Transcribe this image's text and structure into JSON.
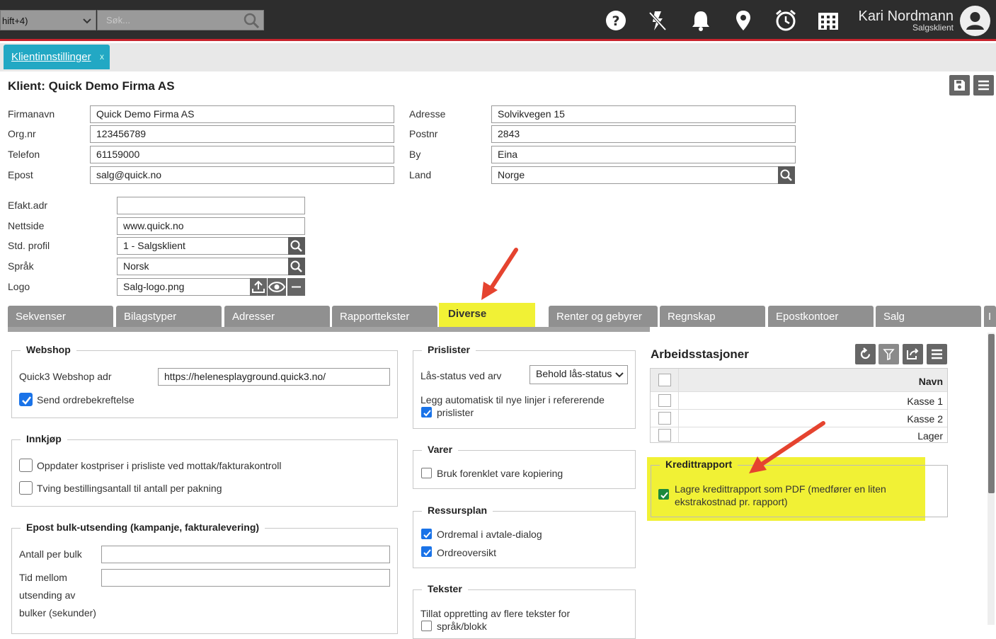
{
  "topbar": {
    "shortcut_text": "hift+4)",
    "search_placeholder": "Søk...",
    "user_name": "Kari Nordmann",
    "user_role": "Salgsklient"
  },
  "app_tab": {
    "label": "Klientinnstillinger",
    "close": "x"
  },
  "page_title": "Klient: Quick Demo Firma AS",
  "client_left": [
    {
      "label": "Firmanavn",
      "value": "Quick Demo Firma AS"
    },
    {
      "label": "Org.nr",
      "value": "123456789"
    },
    {
      "label": "Telefon",
      "value": "61159000"
    },
    {
      "label": "Epost",
      "value": "salg@quick.no"
    }
  ],
  "client_right": [
    {
      "label": "Adresse",
      "value": "Solvikvegen 15"
    },
    {
      "label": "Postnr",
      "value": "2843"
    },
    {
      "label": "By",
      "value": "Eina"
    },
    {
      "label": "Land",
      "value": "Norge"
    }
  ],
  "client_extra": [
    {
      "label": "Efakt.adr",
      "value": ""
    },
    {
      "label": "Nettside",
      "value": "www.quick.no"
    },
    {
      "label": "Std. profil",
      "value": "1 - Salgsklient"
    },
    {
      "label": "Språk",
      "value": "Norsk"
    },
    {
      "label": "Logo",
      "value": "Salg-logo.png"
    }
  ],
  "tabs": [
    "Sekvenser",
    "Bilagstyper",
    "Adresser",
    "Rapporttekster",
    "Diverse",
    "Renter og gebyrer",
    "Regnskap",
    "Epostkontoer",
    "Salg",
    "I"
  ],
  "webshop": {
    "title": "Webshop",
    "adr_label": "Quick3 Webshop adr",
    "adr_value": "https://helenesplayground.quick3.no/",
    "send_label": "Send ordrebekreftelse",
    "send_checked": true
  },
  "innkjop": {
    "title": "Innkjøp",
    "opt1": "Oppdater kostpriser i prisliste ved mottak/fakturakontroll",
    "opt1_checked": false,
    "opt2": "Tving bestillingsantall til antall per pakning",
    "opt2_checked": false
  },
  "epost_bulk": {
    "title": "Epost bulk-utsending (kampanje, fakturalevering)",
    "antall_label": "Antall per bulk",
    "antall_value": "",
    "tid_label_1": "Tid mellom",
    "tid_label_2": "utsending av",
    "tid_label_3": "bulker (sekunder)",
    "tid_value": ""
  },
  "prislister": {
    "title": "Prislister",
    "las_label": "Lås-status ved arv",
    "las_value": "Behold lås-status",
    "auto_label_1": "Legg automatisk til nye linjer i refererende",
    "auto_label_2": "prislister",
    "auto_checked": true
  },
  "varer": {
    "title": "Varer",
    "opt": "Bruk forenklet vare kopiering",
    "checked": false
  },
  "ressursplan": {
    "title": "Ressursplan",
    "opt1": "Ordremal i avtale-dialog",
    "opt1_checked": true,
    "opt2": "Ordreoversikt",
    "opt2_checked": true
  },
  "tekster": {
    "title": "Tekster",
    "opt1": "Tillat oppretting av flere tekster for",
    "opt2": "språk/blokk"
  },
  "arbeidsstasjoner": {
    "title": "Arbeidsstasjoner",
    "column": "Navn",
    "rows": [
      "Kasse 1",
      "Kasse 2",
      "Lager"
    ]
  },
  "kredittrapport": {
    "title": "Kredittrapport",
    "opt_line1": "Lagre kredittrapport som PDF (medfører en liten",
    "opt_line2": "ekstrakostnad pr. rapport)",
    "checked": true
  },
  "colors": {
    "accent": "#22a8c4",
    "highlight": "#f1f135",
    "arrow": "#e5432f",
    "topbar": "#2d2d2d",
    "topbar_border": "#c8232c"
  }
}
